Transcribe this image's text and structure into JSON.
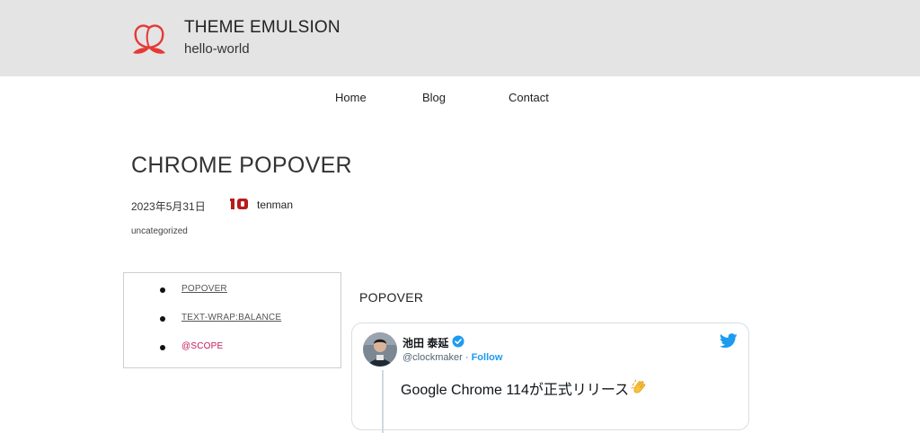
{
  "site": {
    "title": "THEME EMULSION",
    "description": "hello-world",
    "logo_icon": "peach-logo-icon"
  },
  "nav": {
    "items": [
      {
        "label": "Home"
      },
      {
        "label": "Blog"
      },
      {
        "label": "Contact"
      }
    ]
  },
  "post": {
    "title": "CHROME POPOVER",
    "date": "2023年5月31日",
    "author": "tenman",
    "category": "uncategorized"
  },
  "toc": {
    "items": [
      {
        "label": "POPOVER",
        "active": false
      },
      {
        "label": "TEXT-WRAP:BALANCE",
        "active": false
      },
      {
        "label": "@SCOPE",
        "active": true
      }
    ]
  },
  "section": {
    "heading": "POPOVER"
  },
  "tweet": {
    "name": "池田 泰延",
    "handle": "@clockmaker",
    "separator": " · ",
    "follow_label": "Follow",
    "text": "Google Chrome 114が正式リリース"
  },
  "colors": {
    "header_bg": "#e4e4e4",
    "logo_red": "#e53935",
    "active_link": "#c2185b",
    "twitter_blue": "#1d9bf0",
    "avatar_red": "#b71c1c"
  }
}
